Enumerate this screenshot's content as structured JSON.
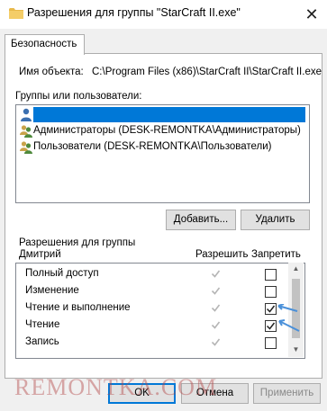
{
  "window": {
    "title": "Разрешения для группы \"StarCraft II.exe\"",
    "close_glyph": "✕"
  },
  "tab": {
    "label": "Безопасность"
  },
  "object": {
    "label": "Имя объекта:",
    "value": "C:\\Program Files (x86)\\StarCraft II\\StarCraft II.exe"
  },
  "groups": {
    "label": "Группы или пользователи:",
    "items": [
      {
        "label": "",
        "icon": "user-icon",
        "selected": true
      },
      {
        "label": "Администраторы (DESK-REMONTKA\\Администраторы)",
        "icon": "group-icon",
        "selected": false
      },
      {
        "label": "Пользователи (DESK-REMONTKA\\Пользователи)",
        "icon": "group-icon",
        "selected": false
      }
    ],
    "add_label": "Добавить...",
    "remove_label": "Удалить"
  },
  "permissions": {
    "header_line1": "Разрешения для группы",
    "header_line2": "Дмитрий",
    "allow_header": "Разрешить",
    "deny_header": "Запретить",
    "rows": [
      {
        "name": "Полный доступ",
        "allow": true,
        "allow_disabled": true,
        "deny": false
      },
      {
        "name": "Изменение",
        "allow": true,
        "allow_disabled": true,
        "deny": false
      },
      {
        "name": "Чтение и выполнение",
        "allow": true,
        "allow_disabled": true,
        "deny": true
      },
      {
        "name": "Чтение",
        "allow": true,
        "allow_disabled": true,
        "deny": true
      },
      {
        "name": "Запись",
        "allow": true,
        "allow_disabled": true,
        "deny": false
      }
    ]
  },
  "buttons": {
    "ok": "OK",
    "cancel": "Отмена",
    "apply": "Применить"
  },
  "watermark": "REMONTKA.COM",
  "colors": {
    "selection": "#0078d7",
    "annotation_arrow": "#4a90d9"
  }
}
